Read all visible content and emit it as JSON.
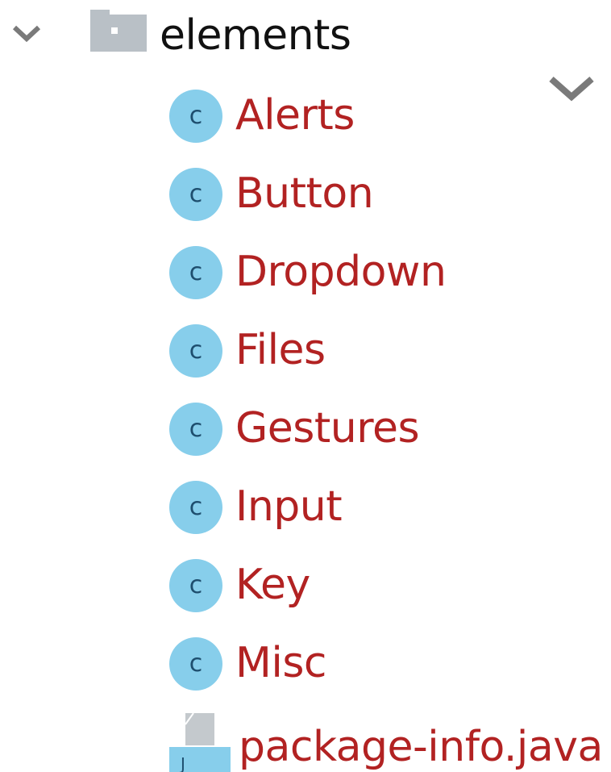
{
  "tree": {
    "folder": {
      "label": "elements",
      "expanded": true,
      "icon": "folder-icon"
    },
    "items": [
      {
        "label": "Alerts",
        "icon": "class-icon",
        "icon_glyph": "c"
      },
      {
        "label": "Button",
        "icon": "class-icon",
        "icon_glyph": "c"
      },
      {
        "label": "Dropdown",
        "icon": "class-icon",
        "icon_glyph": "c"
      },
      {
        "label": "Files",
        "icon": "class-icon",
        "icon_glyph": "c"
      },
      {
        "label": "Gestures",
        "icon": "class-icon",
        "icon_glyph": "c"
      },
      {
        "label": "Input",
        "icon": "class-icon",
        "icon_glyph": "c"
      },
      {
        "label": "Key",
        "icon": "class-icon",
        "icon_glyph": "c"
      },
      {
        "label": "Misc",
        "icon": "class-icon",
        "icon_glyph": "c"
      }
    ],
    "package_file": {
      "label": "package-info.java",
      "icon": "java-file-icon",
      "icon_glyph": "J"
    }
  },
  "colors": {
    "class_label": "#b22222",
    "folder_label": "#111111",
    "class_icon_bg": "#87ceeb",
    "chevron": "#7a7a7a",
    "folder_icon": "#b9c0c6"
  }
}
